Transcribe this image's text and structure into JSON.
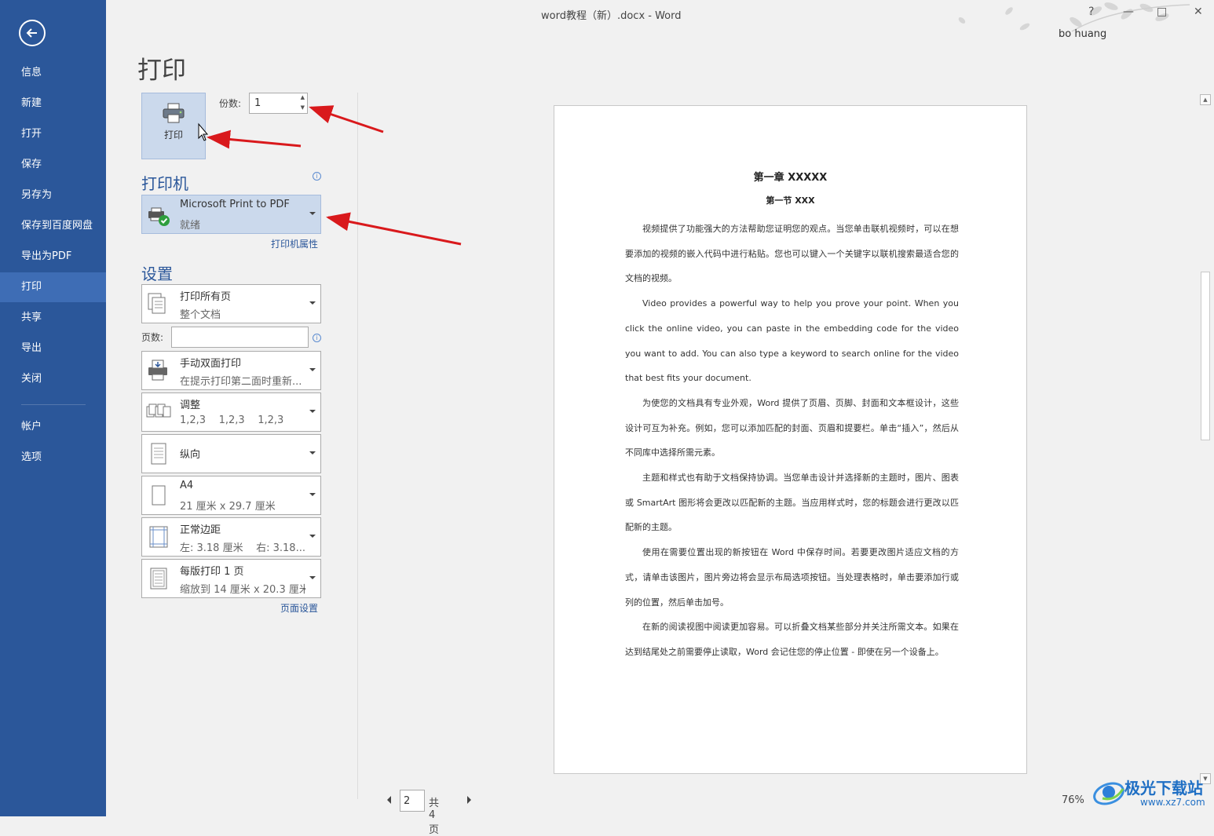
{
  "window": {
    "title": "word教程（新）.docx - Word",
    "help": "?",
    "minimize": "—",
    "maximize": "□",
    "close": "✕",
    "user": "bo huang"
  },
  "sidebar": {
    "items": [
      {
        "label": "信息"
      },
      {
        "label": "新建"
      },
      {
        "label": "打开"
      },
      {
        "label": "保存"
      },
      {
        "label": "另存为"
      },
      {
        "label": "保存到百度网盘"
      },
      {
        "label": "导出为PDF"
      },
      {
        "label": "打印"
      },
      {
        "label": "共享"
      },
      {
        "label": "导出"
      },
      {
        "label": "关闭"
      },
      {
        "label": "帐户"
      },
      {
        "label": "选项"
      }
    ],
    "active": "打印"
  },
  "print": {
    "title": "打印",
    "button_label": "打印",
    "copies_label": "份数:",
    "copies_value": "1"
  },
  "printer": {
    "heading": "打印机",
    "name": "Microsoft Print to PDF",
    "status": "就绪",
    "properties_link": "打印机属性"
  },
  "settings": {
    "heading": "设置",
    "pages_label": "页数:",
    "pages_value": "",
    "options": [
      {
        "line1": "打印所有页",
        "line2": "整个文档",
        "icon": "pages-icon"
      },
      {
        "line1": "手动双面打印",
        "line2": "在提示打印第二面时重新...",
        "icon": "duplex-icon"
      },
      {
        "line1": "调整",
        "line2": "1,2,3    1,2,3    1,2,3",
        "icon": "collate-icon"
      },
      {
        "line1": "纵向",
        "line2": "",
        "icon": "portrait-icon"
      },
      {
        "line1": "A4",
        "line2": "21 厘米 x 29.7 厘米",
        "icon": "paper-size-icon"
      },
      {
        "line1": "正常边距",
        "line2": "左: 3.18 厘米    右: 3.18...",
        "icon": "margins-icon"
      },
      {
        "line1": "每版打印 1 页",
        "line2": "缩放到 14 厘米 x 20.3 厘米",
        "icon": "pages-per-sheet-icon"
      }
    ],
    "page_setup_link": "页面设置"
  },
  "preview": {
    "heading1": "第一章  XXXXX",
    "heading2": "第一节  XXX",
    "paragraphs": [
      "视频提供了功能强大的方法帮助您证明您的观点。当您单击联机视频时，可以在想要添加的视频的嵌入代码中进行粘贴。您也可以键入一个关键字以联机搜索最适合您的文档的视频。",
      "Video provides a powerful way to help you prove your point. When you click the online video, you can paste in the embedding code for the video you want to add. You can also type a keyword to search online for the video that best fits your document.",
      "为使您的文档具有专业外观，Word 提供了页眉、页脚、封面和文本框设计，这些设计可互为补充。例如，您可以添加匹配的封面、页眉和提要栏。单击“插入”，然后从不同库中选择所需元素。",
      "主题和样式也有助于文档保持协调。当您单击设计并选择新的主题时，图片、图表或 SmartArt 图形将会更改以匹配新的主题。当应用样式时，您的标题会进行更改以匹配新的主题。",
      "使用在需要位置出现的新按钮在 Word 中保存时间。若要更改图片适应文档的方式，请单击该图片，图片旁边将会显示布局选项按钮。当处理表格时，单击要添加行或列的位置，然后单击加号。",
      "在新的阅读视图中阅读更加容易。可以折叠文档某些部分并关注所需文本。如果在达到结尾处之前需要停止读取，Word 会记住您的停止位置 - 即使在另一个设备上。"
    ]
  },
  "pager": {
    "current": "2",
    "total": "共 4 页"
  },
  "zoom": "76%",
  "watermark": {
    "line1": "极光下载站",
    "line2": "www.xz7.com"
  },
  "colors": {
    "sidebar": "#2b579a",
    "sidebar_active": "#3e6db5",
    "accent": "#2b579a",
    "annotation_arrow": "#d9191c"
  }
}
